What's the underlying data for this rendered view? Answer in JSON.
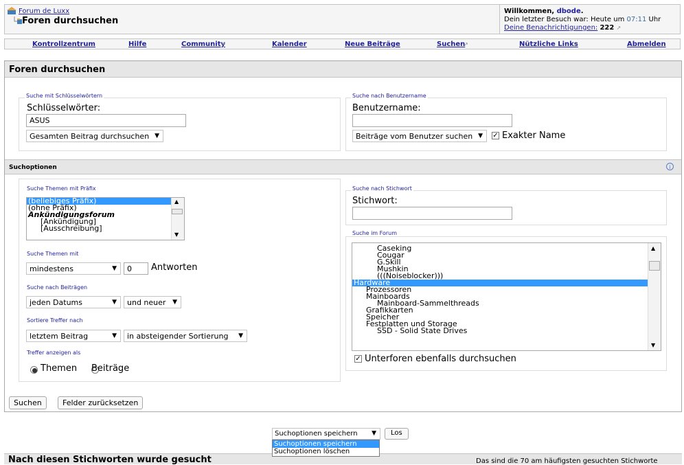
{
  "header": {
    "breadcrumb": "Forum de Luxx",
    "title": "Foren durchsuchen",
    "welcome_prefix": "Willkommen, ",
    "username": "dbode",
    "welcome_suffix": ".",
    "last_visit_text": "Dein letzter Besuch war: Heute um ",
    "last_visit_time": "07:11",
    "last_visit_suffix": " Uhr",
    "notifications_label": "Deine Benachrichtigungen:",
    "notifications_count": "222"
  },
  "navbar": {
    "items": [
      "Kontrollzentrum",
      "Hilfe",
      "Community",
      "Kalender",
      "Neue Beiträge",
      "Suchen",
      "Nützliche Links",
      "Abmelden"
    ]
  },
  "panel": {
    "title": "Foren durchsuchen",
    "keyword": {
      "legend": "Suche mit Schlüsselwörtern",
      "label": "Schlüsselwörter:",
      "value": "ASUS",
      "scope": "Gesamten Beitrag durchsuchen"
    },
    "username": {
      "legend": "Suche nach Benutzername",
      "label": "Benutzername:",
      "value": "",
      "scope": "Beiträge vom Benutzer suchen",
      "exact_label": "Exakter Name"
    }
  },
  "options": {
    "title": "Suchoptionen",
    "prefix": {
      "legend": "Suche Themen mit Präfix",
      "items": [
        "(beliebiges Präfix)",
        "(ohne Präfix)",
        "Ankündigungsforum",
        "[Ankündigung]",
        "[Ausschreibung]"
      ]
    },
    "replies": {
      "legend": "Suche Themen mit",
      "mode": "mindestens",
      "count": "0",
      "suffix": "Antworten"
    },
    "date": {
      "legend": "Suche nach Beiträgen",
      "range": "jeden Datums",
      "direction": "und neuer"
    },
    "sort": {
      "legend": "Sortiere Treffer nach",
      "field": "letztem Beitrag",
      "order": "in absteigender Sortierung"
    },
    "show": {
      "legend": "Treffer anzeigen als",
      "opt1": "Themen",
      "opt2": "Beiträge"
    },
    "tag": {
      "legend": "Suche nach Stichwort",
      "label": "Stichwort:",
      "value": ""
    },
    "forum": {
      "legend": "Suche im Forum",
      "items": [
        "Caseking",
        "Cougar",
        "G.Skill",
        "Mushkin",
        "(((Noiseblocker)))",
        "Hardware",
        "Prozessoren",
        "Mainboards",
        "Mainboard-Sammelthreads",
        "Grafikkarten",
        "Speicher",
        "Festplatten und Storage",
        "SSD - Solid State Drives"
      ],
      "subforums_label": "Unterforen ebenfalls durchsuchen"
    }
  },
  "buttons": {
    "search": "Suchen",
    "reset": "Felder zurücksetzen"
  },
  "save_options": {
    "selected": "Suchoptionen speichern",
    "items": [
      "Suchoptionen speichern",
      "Suchoptionen löschen"
    ],
    "go": "Los"
  },
  "bottom": {
    "title": "Nach diesen Stichworten wurde gesucht",
    "info": "Das sind die 70 am häufigsten gesuchten Stichworte"
  }
}
